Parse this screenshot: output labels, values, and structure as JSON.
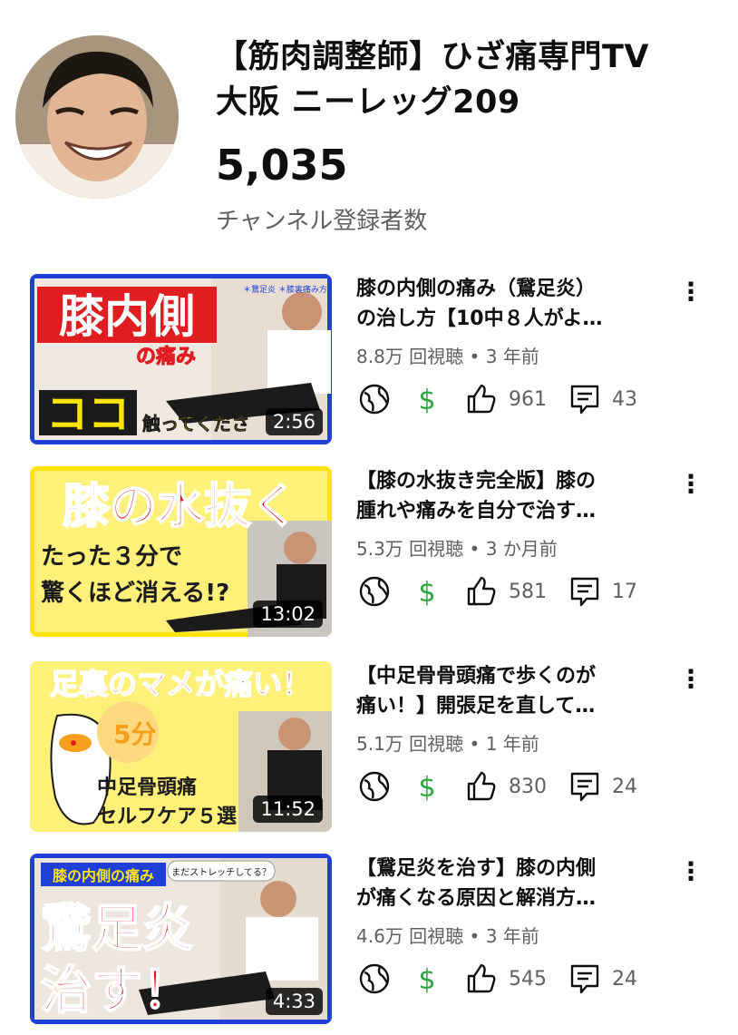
{
  "channel": {
    "name_line1": "【筋肉調整師】ひざ痛専門TV",
    "name_line2": "大阪 ニーレッグ209",
    "subscriber_count": "5,035",
    "subscriber_label": "チャンネル登録者数"
  },
  "videos": [
    {
      "title_line1": "膝の内側の痛み（鵞足炎）",
      "title_line2": "の治し方【10中８人がよ…",
      "views": "8.8万 回視聴",
      "age": "3 年前",
      "likes": "961",
      "comments": "43",
      "duration": "2:56",
      "thumb_text": {
        "main": "膝内側",
        "sub": "の痛み",
        "big": "ココ",
        "cta": "触ってくださ",
        "notes": "＊鵞足炎 ＊膝裏痛み方必須"
      }
    },
    {
      "title_line1": "【膝の水抜き完全版】膝の",
      "title_line2": "腫れや痛みを自分で治す…",
      "views": "5.3万 回視聴",
      "age": "3 か月前",
      "likes": "581",
      "comments": "17",
      "duration": "13:02",
      "thumb_text": {
        "main": "膝の水抜く",
        "line2": "たった３分で",
        "line3": "驚くほど消える!?"
      }
    },
    {
      "title_line1": "【中足骨骨頭痛で歩くのが",
      "title_line2": "痛い！】開張足を直して…",
      "views": "5.1万 回視聴",
      "age": "1 年前",
      "likes": "830",
      "comments": "24",
      "duration": "11:52",
      "thumb_text": {
        "main": "足裏のマメが痛い！",
        "minutes": "5分",
        "line2": "中足骨頭痛",
        "line3": "セルフケア５選"
      }
    },
    {
      "title_line1": "【鵞足炎を治す】膝の内側",
      "title_line2": "が痛くなる原因と解消方…",
      "views": "4.6万 回視聴",
      "age": "3 年前",
      "likes": "545",
      "comments": "24",
      "duration": "4:33",
      "thumb_text": {
        "tag": "膝の内側の痛み",
        "bubble": "まだストレッチしてる？",
        "main1": "鵞足炎",
        "main2": "治す！"
      }
    }
  ],
  "colors": {
    "money": "#2ba640",
    "meta": "#606060",
    "thumb_border_blue": "#1f3fd6",
    "thumb_red": "#e01e22",
    "thumb_yellow": "#ffe500"
  },
  "icons": [
    "globe-icon",
    "dollar-icon",
    "thumbs-up-icon",
    "comment-icon",
    "more-vert-icon"
  ]
}
